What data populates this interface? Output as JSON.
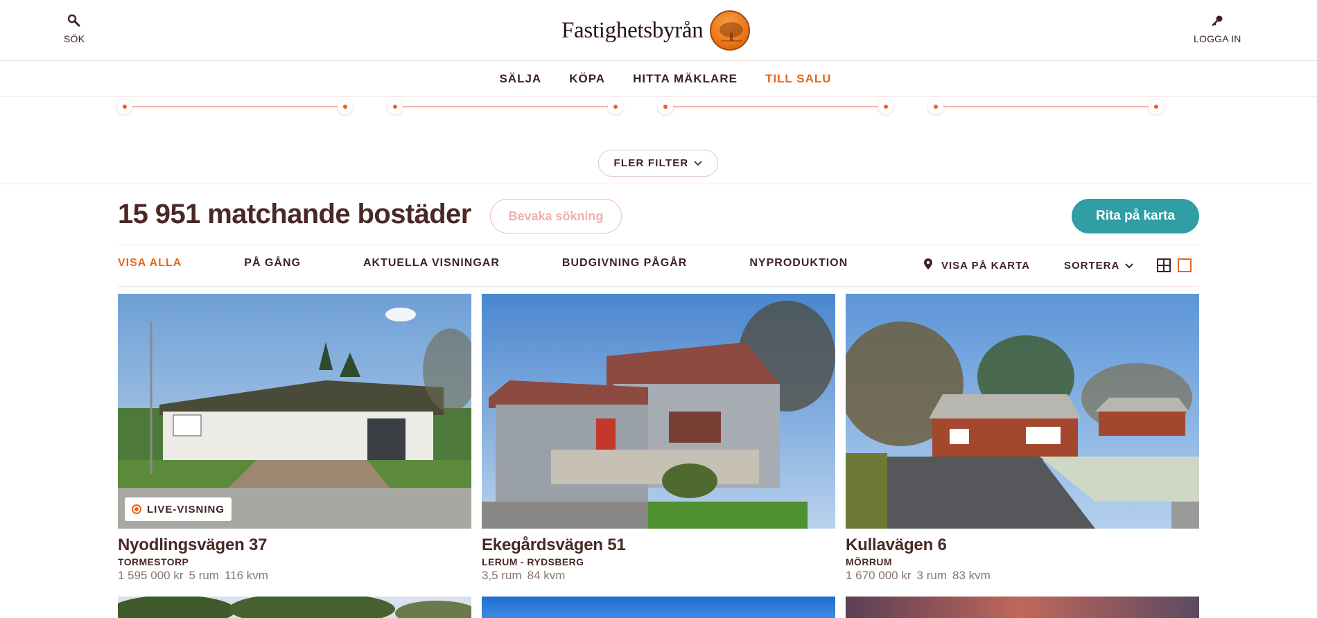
{
  "header": {
    "search_label": "SÖK",
    "login_label": "LOGGA IN",
    "logo_text": "Fastighetsbyrån"
  },
  "nav": {
    "items": [
      {
        "label": "SÄLJA"
      },
      {
        "label": "KÖPA"
      },
      {
        "label": "HITTA MÄKLARE"
      },
      {
        "label": "TILL SALU"
      }
    ],
    "active": "TILL SALU"
  },
  "filters": {
    "more_filters_label": "FLER FILTER"
  },
  "results": {
    "count_text": "15 951 matchande bostäder",
    "watch_label": "Bevaka sökning",
    "draw_map_label": "Rita på karta"
  },
  "tabs": [
    {
      "label": "VISA ALLA"
    },
    {
      "label": "PÅ GÅNG"
    },
    {
      "label": "AKTUELLA VISNINGAR"
    },
    {
      "label": "BUDGIVNING PÅGÅR"
    },
    {
      "label": "NYPRODUKTION"
    }
  ],
  "tools": {
    "map_label": "VISA PÅ KARTA",
    "sort_label": "SORTERA"
  },
  "colors": {
    "accent": "#e8651a",
    "text": "#4a2826",
    "teal": "#2f9ea5",
    "slider_track": "#f2b6a8"
  },
  "listings": [
    {
      "title": "Nyodlingsvägen 37",
      "location": "TORMESTORP",
      "price": "1 595 000 kr",
      "rooms": "5 rum",
      "size": "116 kvm",
      "badge": "LIVE-VISNING"
    },
    {
      "title": "Ekegårdsvägen 51",
      "location": "LERUM - RYDSBERG",
      "price": "",
      "rooms": "3,5 rum",
      "size": "84 kvm",
      "badge": ""
    },
    {
      "title": "Kullavägen 6",
      "location": "MÖRRUM",
      "price": "1 670 000 kr",
      "rooms": "3 rum",
      "size": "83 kvm",
      "badge": ""
    }
  ]
}
